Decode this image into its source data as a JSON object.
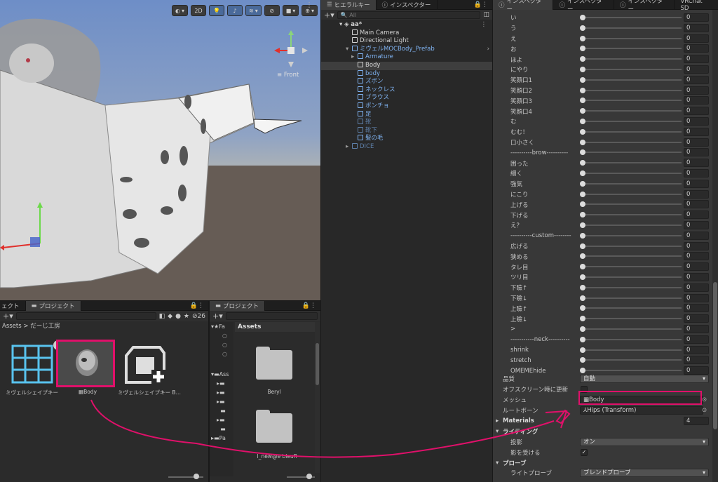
{
  "scene": {
    "toolbar": {
      "mode_2d": "2D"
    },
    "gizmo": {
      "view_label": "≡ Front"
    }
  },
  "hierarchy": {
    "tabs": [
      {
        "label": "ヒエラルキー",
        "icon": "list-icon"
      },
      {
        "label": "インスペクター",
        "icon": "info-icon"
      }
    ],
    "search_placeholder": "All",
    "scene_name": "aa*",
    "items": [
      {
        "label": "Main Camera",
        "indent": 1,
        "style": "normal"
      },
      {
        "label": "Directional Light",
        "indent": 1,
        "style": "normal"
      },
      {
        "label": "ミヴェルMOCBody_Prefab",
        "indent": 1,
        "style": "blue"
      },
      {
        "label": "Armature",
        "indent": 2,
        "style": "blue"
      },
      {
        "label": "Body",
        "indent": 2,
        "style": "normal"
      },
      {
        "label": "body",
        "indent": 2,
        "style": "blue"
      },
      {
        "label": "ズボン",
        "indent": 2,
        "style": "blue"
      },
      {
        "label": "ネックレス",
        "indent": 2,
        "style": "blue"
      },
      {
        "label": "ブラウス",
        "indent": 2,
        "style": "blue"
      },
      {
        "label": "ポンチョ",
        "indent": 2,
        "style": "blue"
      },
      {
        "label": "足",
        "indent": 2,
        "style": "blue"
      },
      {
        "label": "靴",
        "indent": 2,
        "style": "dim"
      },
      {
        "label": "靴下",
        "indent": 2,
        "style": "dim"
      },
      {
        "label": "髪の毛",
        "indent": 2,
        "style": "blue"
      },
      {
        "label": "DICE",
        "indent": 1,
        "style": "dim"
      }
    ]
  },
  "inspector": {
    "tabs": [
      "インスペクター",
      "インスペクター",
      "インスペクター",
      "VRChat SD"
    ],
    "blendshapes": [
      {
        "label": "い",
        "value": "0"
      },
      {
        "label": "う",
        "value": "0"
      },
      {
        "label": "え",
        "value": "0"
      },
      {
        "label": "お",
        "value": "0"
      },
      {
        "label": "ほよ",
        "value": "0"
      },
      {
        "label": "にやり",
        "value": "0"
      },
      {
        "label": "笑顔口1",
        "value": "0"
      },
      {
        "label": "笑顔口2",
        "value": "0"
      },
      {
        "label": "笑顔口3",
        "value": "0"
      },
      {
        "label": "笑顔口4",
        "value": "0"
      },
      {
        "label": "む",
        "value": "0"
      },
      {
        "label": "むむ！",
        "value": "0"
      },
      {
        "label": "口小さく",
        "value": "0"
      },
      {
        "label": "----------brow----------",
        "value": "0"
      },
      {
        "label": "困った",
        "value": "0"
      },
      {
        "label": "細く",
        "value": "0"
      },
      {
        "label": "強気",
        "value": "0"
      },
      {
        "label": "にこり",
        "value": "0"
      },
      {
        "label": "上げる",
        "value": "0"
      },
      {
        "label": "下げる",
        "value": "0"
      },
      {
        "label": "え？",
        "value": "0"
      },
      {
        "label": "----------custom--------",
        "value": "0"
      },
      {
        "label": "広げる",
        "value": "0"
      },
      {
        "label": "狭める",
        "value": "0"
      },
      {
        "label": "タレ目",
        "value": "0"
      },
      {
        "label": "ツリ目",
        "value": "0"
      },
      {
        "label": "下瞼↑",
        "value": "0"
      },
      {
        "label": "下瞼↓",
        "value": "0"
      },
      {
        "label": "上瞼↑",
        "value": "0"
      },
      {
        "label": "上瞼↓",
        "value": "0"
      },
      {
        "label": ">",
        "value": "0"
      },
      {
        "label": "-----------neck----------",
        "value": "0"
      },
      {
        "label": "shrink",
        "value": "0"
      },
      {
        "label": "stretch",
        "value": "0"
      },
      {
        "label": "OMEMEhide",
        "value": "0"
      }
    ],
    "quality": {
      "label": "品質",
      "value": "自動"
    },
    "offscreen": {
      "label": "オフスクリーン時に更新"
    },
    "mesh": {
      "label": "メッシュ",
      "value": "Body"
    },
    "root_bone": {
      "label": "ルートボーン",
      "value": "Hips (Transform)"
    },
    "materials": {
      "label": "Materials",
      "count": "4"
    },
    "lighting": {
      "label": "ライティング"
    },
    "cast_shadows": {
      "label": "投影",
      "value": "オン"
    },
    "receive_shadows": {
      "label": "影を受ける",
      "check": "✓"
    },
    "probes": {
      "label": "プローブ"
    },
    "light_probes": {
      "label": "ライトプローブ",
      "value": "ブレンドプローブ"
    }
  },
  "project1": {
    "tabs": [
      {
        "label": "ェクト"
      },
      {
        "label": "プロジェクト"
      }
    ],
    "breadcrumb": [
      "Assets",
      "だーじ工房"
    ],
    "count": "26",
    "assets": [
      {
        "label": "ミヴェルシェイプキー"
      },
      {
        "label": "Body"
      },
      {
        "label": "ミヴェルシェイプキー B…"
      }
    ]
  },
  "project2": {
    "tab": "プロジェクト",
    "tree": [
      "Fa",
      "Ass",
      "Pa"
    ],
    "header": "Assets",
    "folders": [
      {
        "label": "Beryl"
      },
      {
        "label": "l_new@e bleufl"
      }
    ]
  },
  "colors": {
    "highlight": "#e0106a",
    "selection_blue": "#7fb2f0"
  }
}
